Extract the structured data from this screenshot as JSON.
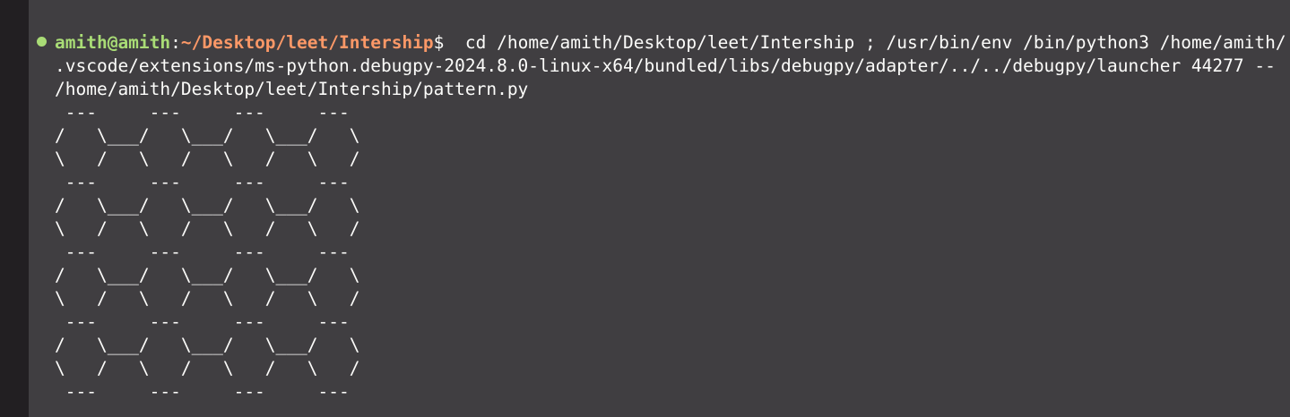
{
  "prompt": {
    "user": "amith@amith",
    "separator": ":",
    "cwd": "~/Desktop/leet/Intership",
    "symbol": "$",
    "command": "  cd /home/amith/Desktop/leet/Intership ; /usr/bin/env /bin/python3 /home/amith/"
  },
  "output": {
    "line_1": ".vscode/extensions/ms-python.debugpy-2024.8.0-linux-x64/bundled/libs/debugpy/adapter/../../debugpy/launcher 44277 --",
    "line_2": "/home/amith/Desktop/leet/Intership/pattern.py",
    "pattern": [
      " ---     ---     ---     ---",
      "/   \\___/   \\___/   \\___/   \\",
      "\\   /   \\   /   \\   /   \\   /",
      " ---     ---     ---     ---",
      "/   \\___/   \\___/   \\___/   \\",
      "\\   /   \\   /   \\   /   \\   /",
      " ---     ---     ---     ---",
      "/   \\___/   \\___/   \\___/   \\",
      "\\   /   \\   /   \\   /   \\   /",
      " ---     ---     ---     ---",
      "/   \\___/   \\___/   \\___/   \\",
      "\\   /   \\   /   \\   /   \\   /",
      " ---     ---     ---     ---"
    ]
  },
  "colors": {
    "background": "#403e41",
    "gutter": "#221f22",
    "user": "#a9dc76",
    "path": "#fc9867",
    "text": "#fcfcfa",
    "status_dot": "#a9dc76"
  }
}
